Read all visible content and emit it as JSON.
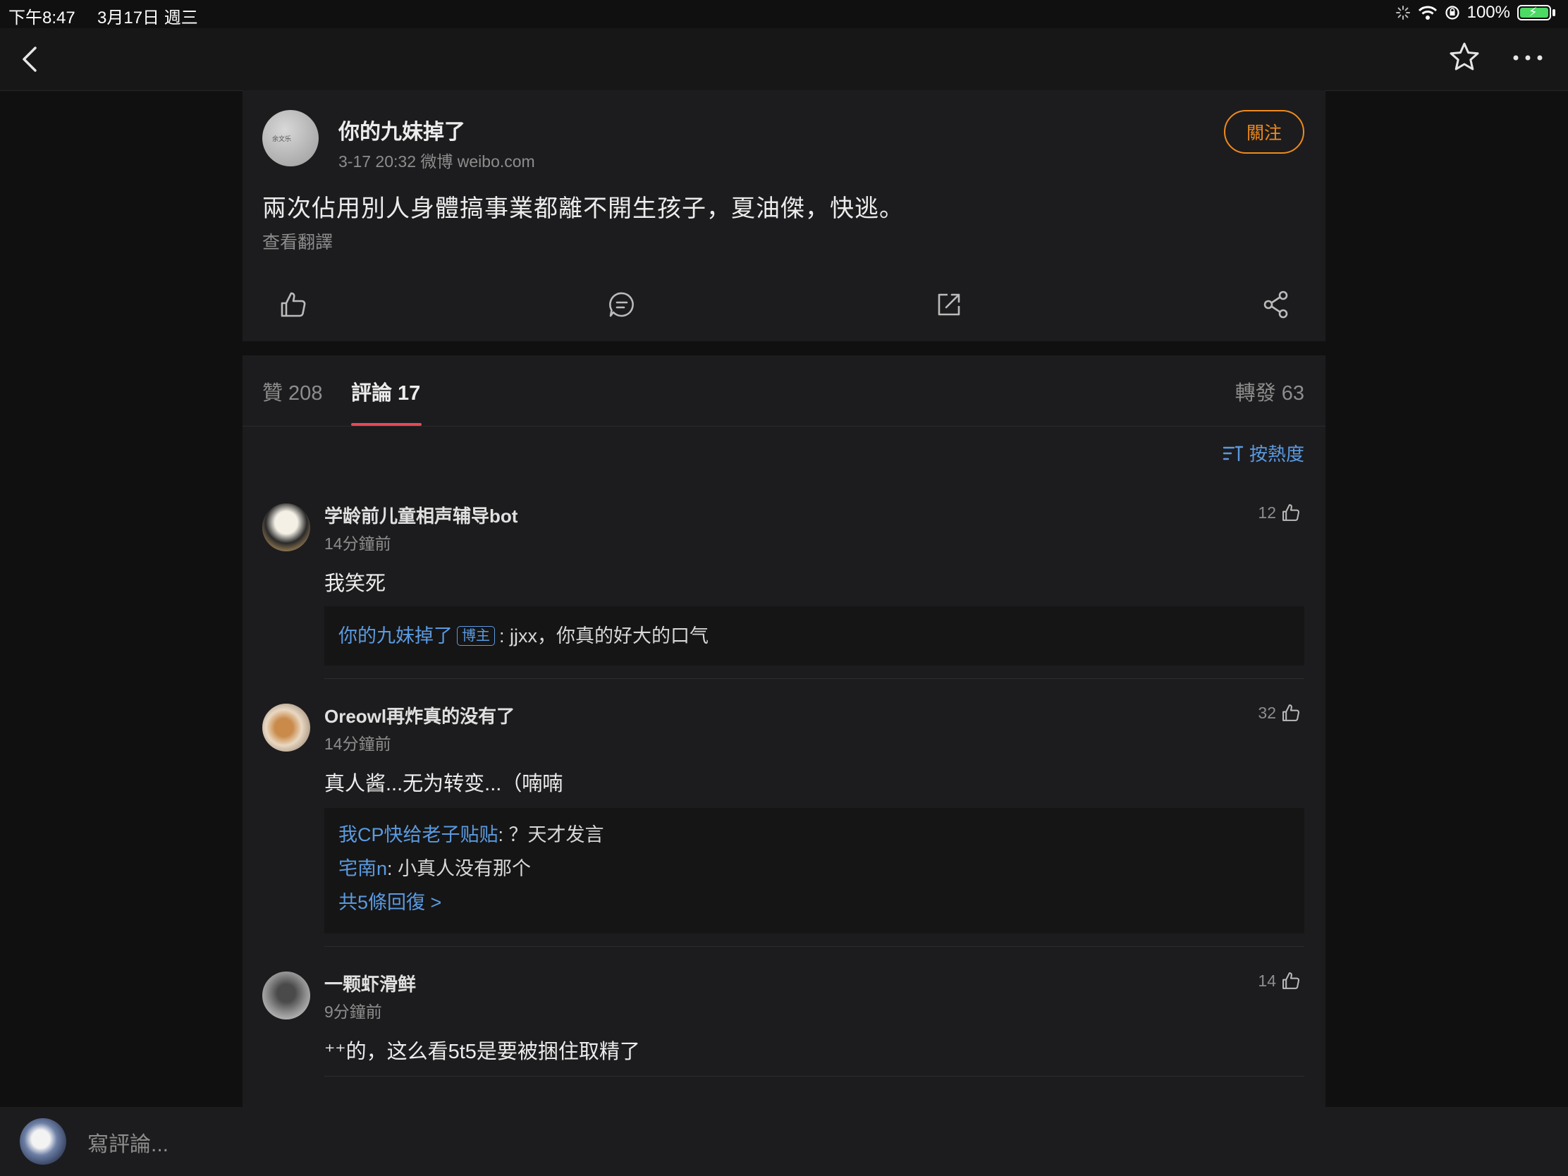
{
  "status_bar": {
    "time": "下午8:47",
    "date": "3月17日 週三",
    "battery": "100%"
  },
  "post": {
    "author": "你的九妹掉了",
    "avatar_text": "余文乐",
    "meta": "3-17 20:32   微博 weibo.com",
    "follow_label": "關注",
    "text": "兩次佔用別人身體搞事業都離不開生孩子，夏油傑，快逃。",
    "translate_label": "查看翻譯"
  },
  "tabs": {
    "likes": "贊 208",
    "comments": "評論 17",
    "reposts": "轉發 63"
  },
  "sort_label": "按熱度",
  "comments": [
    {
      "name": "学龄前儿童相声辅导bot",
      "time": "14分鐘前",
      "likes": "12",
      "text": "我笑死",
      "replies": [
        {
          "user": "你的九妹掉了",
          "badge": "博主",
          "text": ": jjxx，你真的好大的口气"
        }
      ]
    },
    {
      "name": "Oreowl再炸真的没有了",
      "time": "14分鐘前",
      "likes": "32",
      "text": "真人酱...无为转变...（喃喃",
      "replies": [
        {
          "user": "我CP快给老子贴贴",
          "text": ": ？天才发言"
        },
        {
          "user": "宅南n",
          "text": ": 小真人没有那个"
        }
      ],
      "more_replies": "共5條回復 >"
    },
    {
      "name": "一颗虾滑鲜",
      "time": "9分鐘前",
      "likes": "14",
      "text": "⁺⁺的，这么看5t5是要被捆住取精了"
    }
  ],
  "bottom_bar": {
    "input_placeholder": "寫評論..."
  },
  "colors": {
    "background": "#101010",
    "card": "#1c1c1e",
    "follow_accent": "#f08a1c",
    "link_blue": "#5b9ae0",
    "tab_underline": "#e94856"
  }
}
